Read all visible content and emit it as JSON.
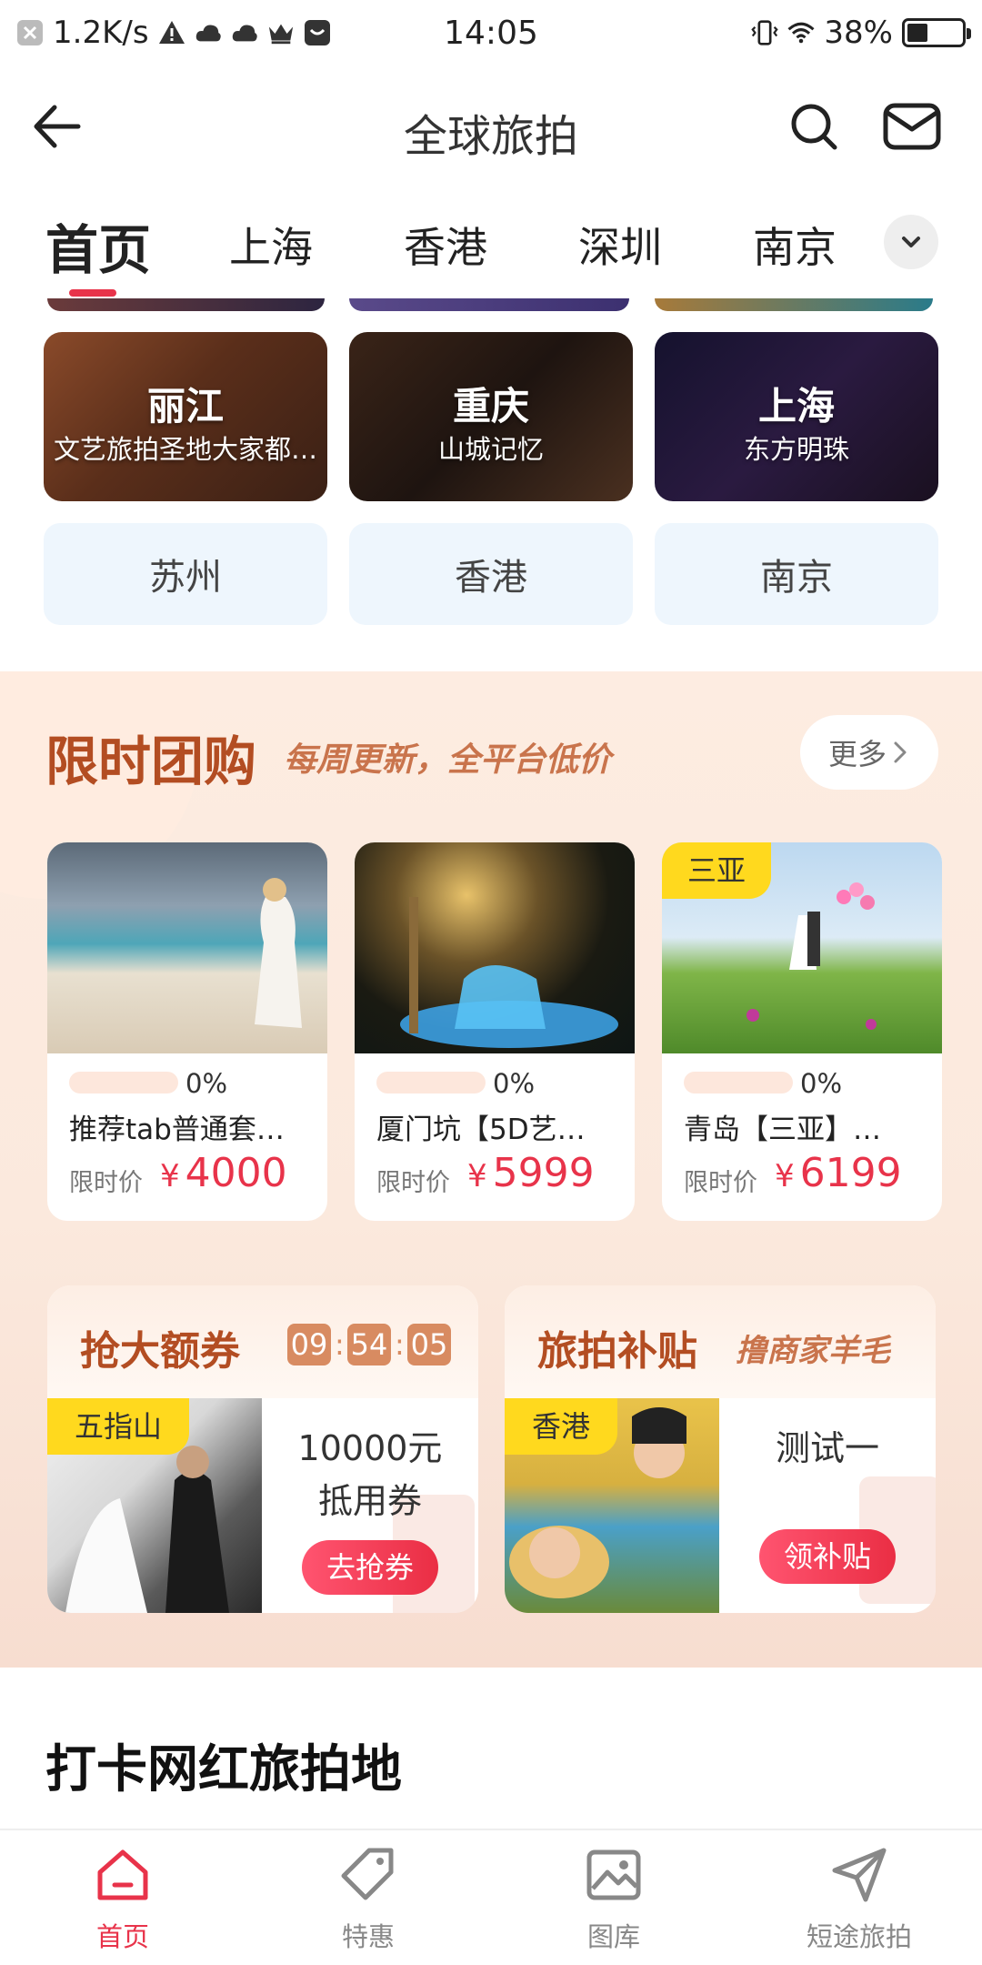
{
  "status_bar": {
    "net_speed": "1.2K/s",
    "time": "14:05",
    "battery_pct": "38%",
    "battery_level": 0.38
  },
  "header": {
    "title": "全球旅拍"
  },
  "tabs": [
    "首页",
    "上海",
    "香港",
    "深圳",
    "南京"
  ],
  "destinations": [
    {
      "name": "丽江",
      "sub": "文艺旅拍圣地大家都…"
    },
    {
      "name": "重庆",
      "sub": "山城记忆"
    },
    {
      "name": "上海",
      "sub": "东方明珠"
    }
  ],
  "cities": [
    "苏州",
    "香港",
    "南京"
  ],
  "group_buy": {
    "title": "限时团购",
    "subtitle": "每周更新，全平台低价",
    "more": "更多",
    "items": [
      {
        "tag": "",
        "progress": "0%",
        "name": "推荐tab普通套…",
        "price_label": "限时价",
        "currency": "¥",
        "price": "4000"
      },
      {
        "tag": "",
        "progress": "0%",
        "name": "厦门坑【5D艺…",
        "price_label": "限时价",
        "currency": "¥",
        "price": "5999"
      },
      {
        "tag": "三亚",
        "progress": "0%",
        "name": "青岛【三亚】…",
        "price_label": "限时价",
        "currency": "¥",
        "price": "6199"
      }
    ]
  },
  "coupon": {
    "title": "抢大额券",
    "timer": [
      "09",
      "54",
      "05"
    ],
    "tag": "五指山",
    "amount": "10000元",
    "kind": "抵用券",
    "button": "去抢券"
  },
  "subsidy": {
    "title": "旅拍补贴",
    "subtitle": "撸商家羊毛",
    "tag": "香港",
    "text": "测试一",
    "button": "领补贴"
  },
  "checkin": {
    "title": "打卡网红旅拍地"
  },
  "bottom_nav": [
    {
      "label": "首页",
      "active": true
    },
    {
      "label": "特惠",
      "active": false
    },
    {
      "label": "图库",
      "active": false
    },
    {
      "label": "短途旅拍",
      "active": false
    }
  ],
  "colors": {
    "accent": "#e8334a",
    "promo_title": "#b34d22",
    "tag_yellow": "#ffd91e"
  }
}
